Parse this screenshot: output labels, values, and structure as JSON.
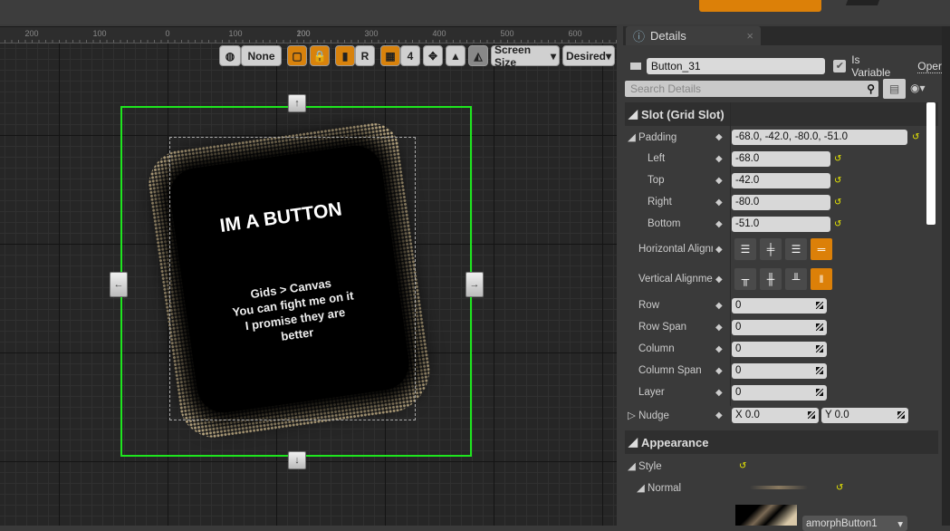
{
  "ruler": {
    "ticks": [
      "200",
      "100",
      "0",
      "100",
      "200",
      "300",
      "400",
      "500",
      "600"
    ]
  },
  "toolbar": {
    "world_icon": "globe-icon",
    "none_label": "None",
    "grid_size": "4",
    "r_label": "R",
    "screen_size": "Screen Size",
    "desired": "Desired"
  },
  "widget": {
    "title": "IM A BUTTON",
    "lines": [
      "Gids > Canvas",
      "You can fight me on it",
      "I promise they are",
      "better"
    ]
  },
  "details": {
    "tab": "Details",
    "close": "×",
    "name_value": "Button_31",
    "is_variable_label": "Is Variable",
    "is_variable": true,
    "open_label": "Oper",
    "search_placeholder": "Search Details",
    "slot_section": "Slot (Grid Slot)",
    "padding": {
      "label": "Padding",
      "value": "-68.0, -42.0, -80.0, -51.0",
      "left_label": "Left",
      "left": "-68.0",
      "top_label": "Top",
      "top": "-42.0",
      "right_label": "Right",
      "right": "-80.0",
      "bottom_label": "Bottom",
      "bottom": "-51.0"
    },
    "h_align_label": "Horizontal Alignment",
    "h_align_selected": "fill",
    "v_align_label": "Vertical Alignment",
    "v_align_selected": "fill",
    "fields": [
      {
        "label": "Row",
        "value": "0"
      },
      {
        "label": "Row Span",
        "value": "0"
      },
      {
        "label": "Column",
        "value": "0"
      },
      {
        "label": "Column Span",
        "value": "0"
      },
      {
        "label": "Layer",
        "value": "0"
      }
    ],
    "nudge": {
      "label": "Nudge",
      "x": "X  0.0",
      "y": "Y  0.0"
    },
    "appearance_section": "Appearance",
    "style_label": "Style",
    "normal_label": "Normal",
    "image_asset": "amorphButton1"
  },
  "colors": {
    "accent": "#dc8008",
    "selection": "#1ee61e",
    "reset": "#eeee00"
  }
}
